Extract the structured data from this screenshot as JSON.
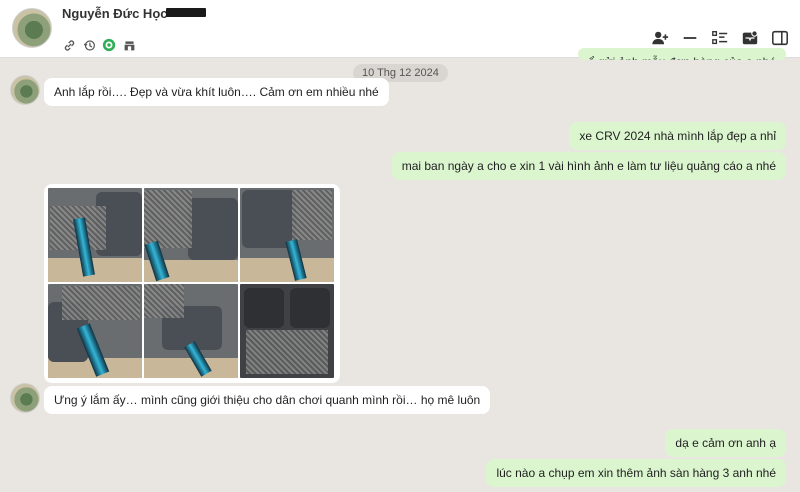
{
  "header": {
    "contact_name": "Nguyễn Đức Học",
    "icons": [
      "link-icon",
      "history-icon",
      "badge-icon",
      "store-icon"
    ],
    "actions": [
      "add-member-icon",
      "minimize-icon",
      "checklist-icon",
      "inbox-icon",
      "side-panel-icon"
    ]
  },
  "chat": {
    "top_partial": "ổ gửi ảnh mẫu đơn hàng của ạ nhé",
    "date_separator": "10 Thg 12 2024",
    "messages": [
      {
        "side": "in",
        "text": "Anh lắp rồi…. Đẹp và vừa khít luôn…. Cảm ơn em nhiều nhé"
      },
      {
        "side": "out",
        "text": "xe CRV 2024  nhà mình lắp đẹp a nhỉ"
      },
      {
        "side": "out",
        "text": "mai  ban ngày a cho e xin 1 vài hình ảnh e  làm tư liệu  quảng cáo a nhé"
      },
      {
        "side": "in",
        "text": "Ưng ý lắm ấy… mình cũng giới thiệu cho dân chơi quanh mình rồi… họ mê luôn"
      },
      {
        "side": "out",
        "text": "dạ e cảm ơn anh ạ"
      },
      {
        "side": "out",
        "text": "lúc nào a chụp em xin thêm ảnh sàn hàng 3 anh nhé"
      }
    ],
    "photo_count": 6
  },
  "colors": {
    "background": "#e9e6e1",
    "incoming_bubble": "#ffffff",
    "outgoing_bubble": "#dbf5cf",
    "date_pill": "#d9d6d1"
  }
}
